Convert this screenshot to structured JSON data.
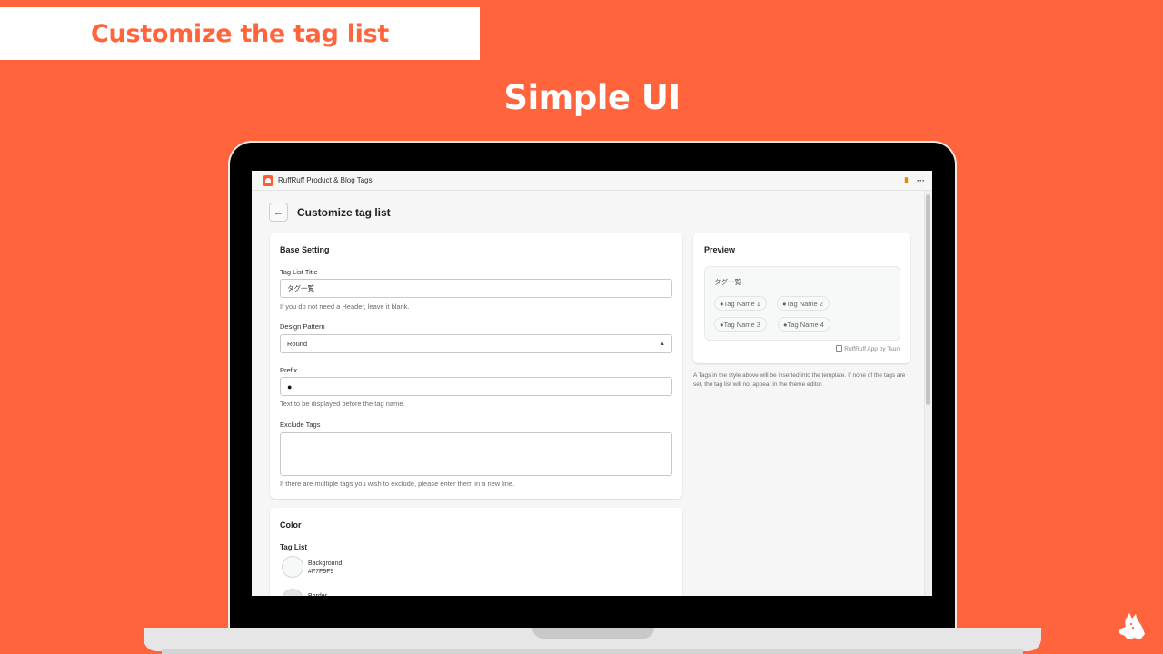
{
  "banner": {
    "title": "Customize the tag list"
  },
  "headline": "Simple UI",
  "app": {
    "name": "RuffRuff Product & Blog Tags",
    "pin_icon": "pin-icon",
    "more_icon": "more-icon"
  },
  "page": {
    "back_icon": "←",
    "title": "Customize tag list"
  },
  "base_setting": {
    "title": "Base Setting",
    "tag_list_title": {
      "label": "Tag List Title",
      "value": "タグ一覧",
      "help": "If you do not need a Header, leave it blank."
    },
    "design_pattern": {
      "label": "Design Pattern",
      "value": "Round"
    },
    "prefix": {
      "label": "Prefix",
      "value": "●",
      "help": "Text to be displayed before the tag name."
    },
    "exclude_tags": {
      "label": "Exclude Tags",
      "value": "",
      "help": "If there are multiple tags you wish to exclude, please enter them in a new line."
    }
  },
  "color": {
    "title": "Color",
    "group": "Tag List",
    "items": [
      {
        "label": "Background",
        "value": "#F7F9F9",
        "swatch": "#F7F9F9"
      },
      {
        "label": "Border",
        "value": "",
        "swatch": "#E3E3E3"
      }
    ]
  },
  "preview": {
    "title": "Preview",
    "list_title": "タグ一覧",
    "tags": [
      "●Tag Name 1",
      "●Tag Name 2",
      "●Tag Name 3",
      "●Tag Name 4"
    ],
    "credit": "RuffRuff App by Tsun",
    "note": "A Tags in the style above will be inserted into the template. If none of the tags are set, the tag list will not appear in the theme editor."
  },
  "colors": {
    "brand": "#FF643C",
    "pin": "#E08A00"
  }
}
